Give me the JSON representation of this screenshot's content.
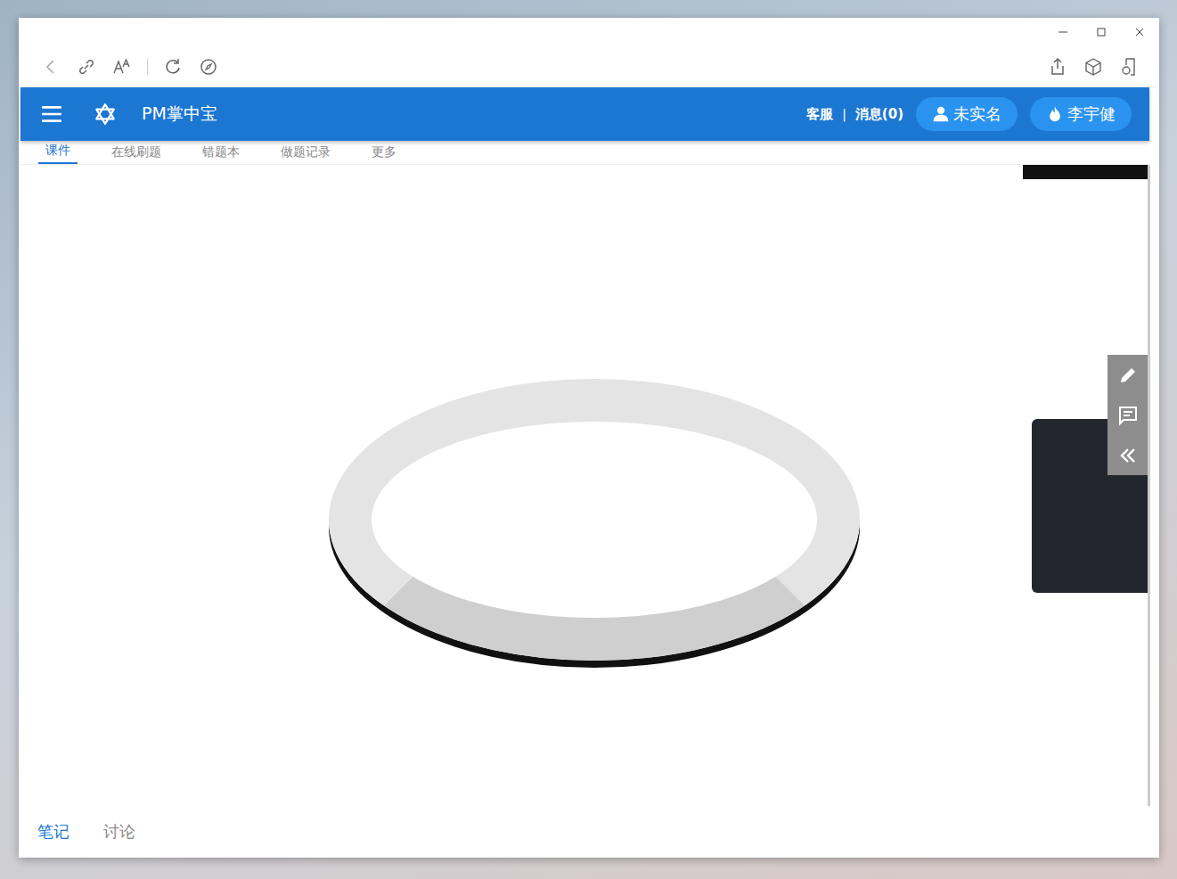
{
  "app": {
    "title": "PM掌中宝",
    "links": [
      "客服",
      "消息(0)"
    ],
    "separator": "|",
    "buttons": [
      {
        "label": "未实名",
        "kind": "verify"
      },
      {
        "label": "李宇健",
        "kind": "user"
      }
    ]
  },
  "tabs": [
    {
      "label": "课件",
      "selected": true
    },
    {
      "label": "在线刷题",
      "selected": false
    },
    {
      "label": "错题本",
      "selected": false
    },
    {
      "label": "做题记录",
      "selected": false
    },
    {
      "label": "更多",
      "selected": false
    }
  ],
  "bottom_tabs": [
    {
      "label": "笔记",
      "selected": true
    },
    {
      "label": "讨论",
      "selected": false
    }
  ]
}
